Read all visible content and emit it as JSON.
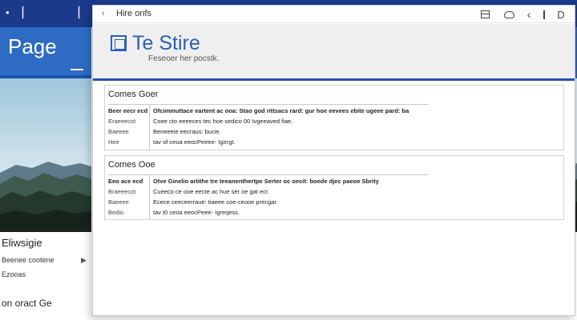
{
  "back_window": {
    "title": "Page",
    "nav_title": "Eliwsigie",
    "nav_items": [
      "Beenee cootene",
      "Ezooas"
    ],
    "footer_text": "on oract Ge"
  },
  "front_window": {
    "titlebar": {
      "title": "Hire onfs"
    },
    "site": {
      "title": "Te Stire",
      "tagline": "Feseoer her pocstk."
    },
    "sections": [
      {
        "title": "Comes Goer",
        "rows": [
          {
            "label": "Beer eecr ecd",
            "value": "Ofcimmuttace eartent ac ooa: Stao god rittsacs rard: gur hoe eevees ebite ugeee pard: ba"
          },
          {
            "label": "Eraeeecot",
            "value": "Coee cto eeeeces tec hoe sedico 00 Ivgeeaved fiae."
          },
          {
            "label": "Baeeee",
            "value": "Beneeeie eecraus: bucie."
          },
          {
            "label": "Hee",
            "value": "tav of ceoa eeocPeeee- Igirrgt."
          }
        ]
      },
      {
        "title": "Comes Ooe",
        "rows": [
          {
            "label": "Eeo ace ecd",
            "value": "Otve Ginelio artithe tre teeanenthertpe Serter oc oecit: boede djec paeoe Sbrity"
          },
          {
            "label": "Braeeecot",
            "value": "Cueeco ce ooe eecte ac hue ser oe gat ecr."
          },
          {
            "label": "Baeeee",
            "value": "Ecece ceeceerraue: tiaeee coe-ceooe precgar."
          },
          {
            "label": "Bedio",
            "value": "tav t0 ceoa eeocPeee- Igreqess."
          }
        ]
      }
    ]
  },
  "colors": {
    "brand_blue": "#2a5fb8",
    "titlebar_dark": "#1b3a8c",
    "header_gray": "#efefef"
  },
  "icons": {
    "tb_back": "chevron-left-icon",
    "tb_btn_1": "panel-icon",
    "tb_btn_2": "cloud-icon",
    "tb_btn_3": "back-arrow-icon",
    "tb_btn_4": "divider-icon"
  }
}
